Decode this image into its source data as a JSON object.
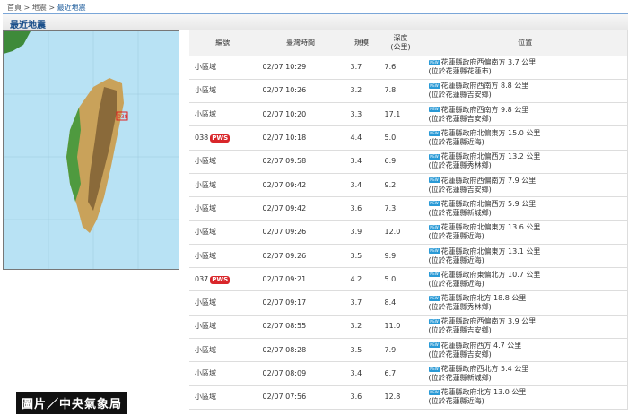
{
  "breadcrumb": [
    "首頁",
    "地震",
    "最近地震"
  ],
  "breadcrumb_sep": ">",
  "title": "最近地震",
  "map": {
    "marker_label": "038"
  },
  "table": {
    "headers": [
      "編號",
      "臺灣時間",
      "規模",
      "深度\n(公里)",
      "位置"
    ],
    "rows": [
      {
        "id": "小區域",
        "pws": "",
        "time": "02/07 10:29",
        "mag": "3.7",
        "depth": "7.6",
        "loc": "花蓮縣政府西偏南方 3.7 公里",
        "sub": "(位於花蓮縣花蓮市)"
      },
      {
        "id": "小區域",
        "pws": "",
        "time": "02/07 10:26",
        "mag": "3.2",
        "depth": "7.8",
        "loc": "花蓮縣政府西南方 8.8 公里",
        "sub": "(位於花蓮縣吉安鄉)"
      },
      {
        "id": "小區域",
        "pws": "",
        "time": "02/07 10:20",
        "mag": "3.3",
        "depth": "17.1",
        "loc": "花蓮縣政府西南方 9.8 公里",
        "sub": "(位於花蓮縣吉安鄉)"
      },
      {
        "id": "038",
        "pws": "PWS",
        "time": "02/07 10:18",
        "mag": "4.4",
        "depth": "5.0",
        "loc": "花蓮縣政府北偏東方 15.0 公里",
        "sub": "(位於花蓮縣近海)"
      },
      {
        "id": "小區域",
        "pws": "",
        "time": "02/07 09:58",
        "mag": "3.4",
        "depth": "6.9",
        "loc": "花蓮縣政府北偏西方 13.2 公里",
        "sub": "(位於花蓮縣秀林鄉)"
      },
      {
        "id": "小區域",
        "pws": "",
        "time": "02/07 09:42",
        "mag": "3.4",
        "depth": "9.2",
        "loc": "花蓮縣政府西偏南方 7.9 公里",
        "sub": "(位於花蓮縣吉安鄉)"
      },
      {
        "id": "小區域",
        "pws": "",
        "time": "02/07 09:42",
        "mag": "3.6",
        "depth": "7.3",
        "loc": "花蓮縣政府北偏西方 5.9 公里",
        "sub": "(位於花蓮縣新城鄉)"
      },
      {
        "id": "小區域",
        "pws": "",
        "time": "02/07 09:26",
        "mag": "3.9",
        "depth": "12.0",
        "loc": "花蓮縣政府北偏東方 13.6 公里",
        "sub": "(位於花蓮縣近海)"
      },
      {
        "id": "小區域",
        "pws": "",
        "time": "02/07 09:26",
        "mag": "3.5",
        "depth": "9.9",
        "loc": "花蓮縣政府北偏東方 13.1 公里",
        "sub": "(位於花蓮縣近海)"
      },
      {
        "id": "037",
        "pws": "PWS",
        "time": "02/07 09:21",
        "mag": "4.2",
        "depth": "5.0",
        "loc": "花蓮縣政府東偏北方 10.7 公里",
        "sub": "(位於花蓮縣近海)"
      },
      {
        "id": "小區域",
        "pws": "",
        "time": "02/07 09:17",
        "mag": "3.7",
        "depth": "8.4",
        "loc": "花蓮縣政府北方 18.8 公里",
        "sub": "(位於花蓮縣秀林鄉)"
      },
      {
        "id": "小區域",
        "pws": "",
        "time": "02/07 08:55",
        "mag": "3.2",
        "depth": "11.0",
        "loc": "花蓮縣政府西偏南方 3.9 公里",
        "sub": "(位於花蓮縣吉安鄉)"
      },
      {
        "id": "小區域",
        "pws": "",
        "time": "02/07 08:28",
        "mag": "3.5",
        "depth": "7.9",
        "loc": "花蓮縣政府西方 4.7 公里",
        "sub": "(位於花蓮縣吉安鄉)"
      },
      {
        "id": "小區域",
        "pws": "",
        "time": "02/07 08:09",
        "mag": "3.4",
        "depth": "6.7",
        "loc": "花蓮縣政府西北方 5.4 公里",
        "sub": "(位於花蓮縣新城鄉)"
      },
      {
        "id": "小區域",
        "pws": "",
        "time": "02/07 07:56",
        "mag": "3.6",
        "depth": "12.8",
        "loc": "花蓮縣政府北方 13.0 公里",
        "sub": "(位於花蓮縣近海)"
      }
    ],
    "new_badge": "NEW"
  },
  "caption": "圖片／中央氣象局"
}
